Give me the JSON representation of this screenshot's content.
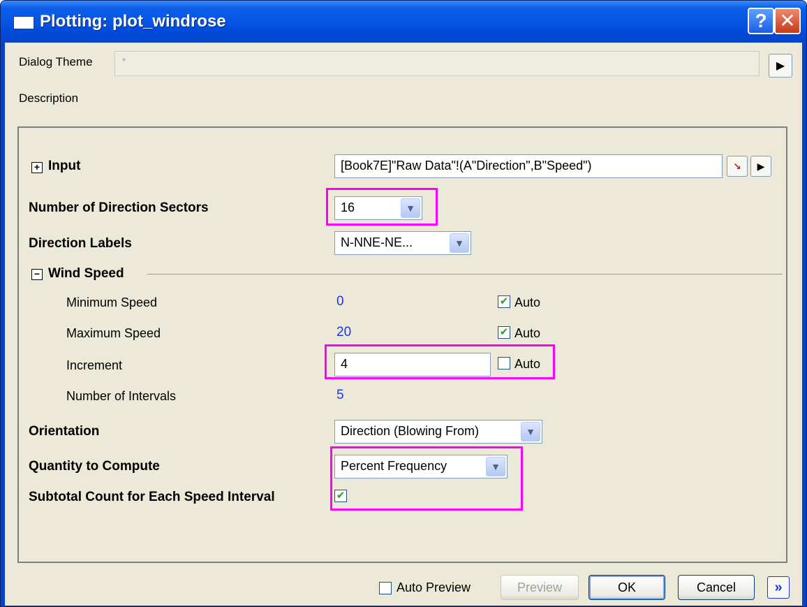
{
  "window": {
    "title": "Plotting: plot_windrose"
  },
  "header": {
    "dialog_theme_label": "Dialog Theme",
    "dialog_theme_value": "*",
    "description_label": "Description"
  },
  "params": {
    "input": {
      "label": "Input",
      "value": "[Book7E]\"Raw Data\"!(A\"Direction\",B\"Speed\")"
    },
    "sectors": {
      "label": "Number of Direction Sectors",
      "value": "16"
    },
    "direction_labels": {
      "label": "Direction Labels",
      "value": "N-NNE-NE..."
    },
    "wind_speed": {
      "label": "Wind Speed",
      "min": {
        "label": "Minimum Speed",
        "value": "0",
        "auto_label": "Auto",
        "auto": true
      },
      "max": {
        "label": "Maximum Speed",
        "value": "20",
        "auto_label": "Auto",
        "auto": true
      },
      "increment": {
        "label": "Increment",
        "value": "4",
        "auto_label": "Auto",
        "auto": false
      },
      "intervals": {
        "label": "Number of Intervals",
        "value": "5"
      }
    },
    "orientation": {
      "label": "Orientation",
      "value": "Direction (Blowing From)"
    },
    "quantity": {
      "label": "Quantity to Compute",
      "value": "Percent Frequency"
    },
    "subtotal": {
      "label": "Subtotal Count for Each Speed Interval",
      "checked": true
    }
  },
  "footer": {
    "auto_preview_label": "Auto Preview",
    "auto_preview": false,
    "preview_label": "Preview",
    "ok_label": "OK",
    "cancel_label": "Cancel",
    "more_label": "»"
  },
  "colors": {
    "highlight": "#ff00ff",
    "value_blue": "#1f37e2",
    "title_bar": "#0655e6",
    "dialog_bg": "#ece9d8"
  }
}
